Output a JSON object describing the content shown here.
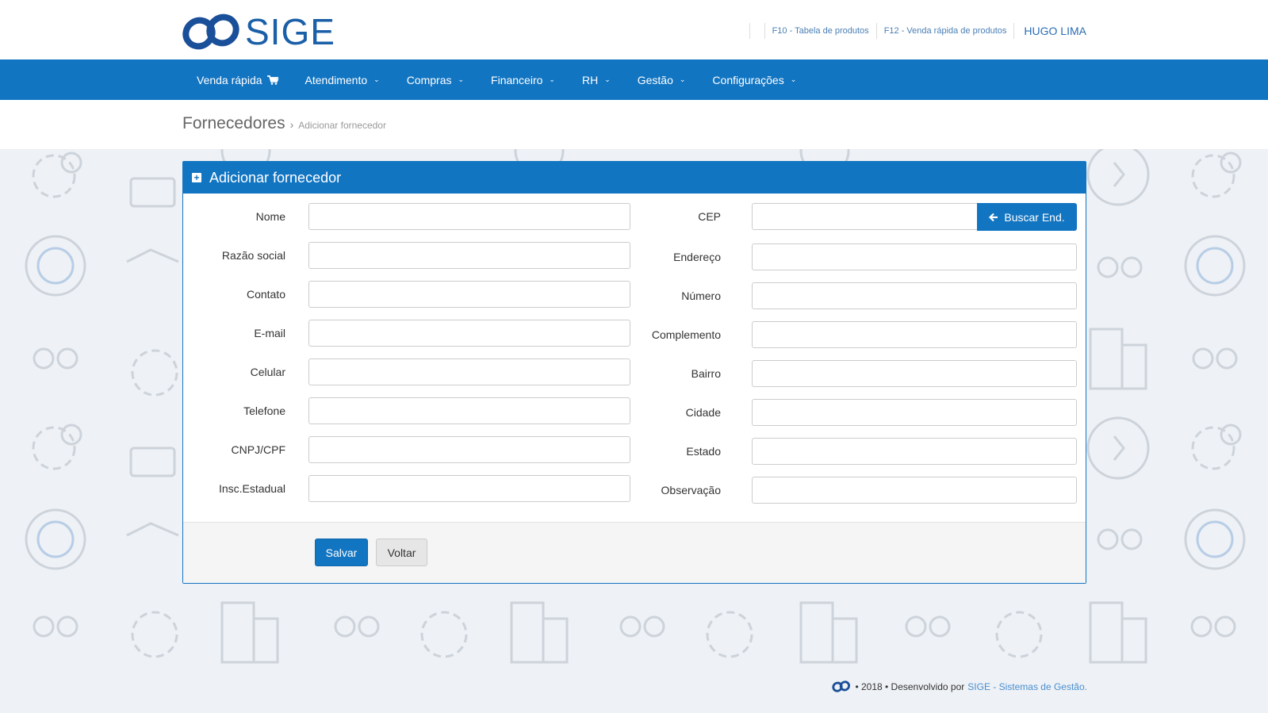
{
  "brand": {
    "logo_text": "SIGE"
  },
  "toplinks": {
    "f10": "F10 - Tabela de produtos",
    "f12": "F12 - Venda rápida de produtos",
    "user": "HUGO LIMA"
  },
  "nav": {
    "items": [
      {
        "label": "Venda rápida",
        "icon": "cart-icon"
      },
      {
        "label": "Atendimento",
        "icon": "chevron-down-icon"
      },
      {
        "label": "Compras",
        "icon": "chevron-down-icon"
      },
      {
        "label": "Financeiro",
        "icon": "chevron-down-icon"
      },
      {
        "label": "RH",
        "icon": "chevron-down-icon"
      },
      {
        "label": "Gestão",
        "icon": "chevron-down-icon"
      },
      {
        "label": "Configurações",
        "icon": "chevron-down-icon"
      }
    ]
  },
  "breadcrumb": {
    "title": "Fornecedores",
    "separator": "›",
    "current": "Adicionar fornecedor"
  },
  "panel": {
    "title": "Adicionar fornecedor",
    "left_fields": [
      "Nome",
      "Razão social",
      "Contato",
      "E-mail",
      "Celular",
      "Telefone",
      "CNPJ/CPF",
      "Insc.Estadual"
    ],
    "right_fields": [
      "CEP",
      "Endereço",
      "Número",
      "Complemento",
      "Bairro",
      "Cidade",
      "Estado",
      "Observação"
    ],
    "buscar_label": "Buscar End.",
    "save_label": "Salvar",
    "back_label": "Voltar"
  },
  "footer": {
    "text": "• 2018 • Desenvolvido por",
    "brand_link": "SIGE - Sistemas de Gestão."
  },
  "colors": {
    "primary": "#1275c2",
    "background": "#eef1f5"
  }
}
